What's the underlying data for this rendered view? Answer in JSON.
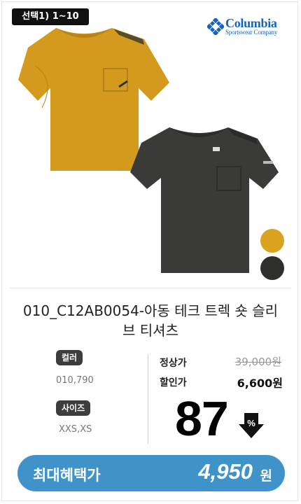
{
  "badge": {
    "label": "선택1) 1~10"
  },
  "brand": {
    "name": "Columbia",
    "sub": "Sportswear Company",
    "color": "#1565c0"
  },
  "product": {
    "title": "010_C12AB0054-아동 테크 트렉 숏 슬리브 티셔츠",
    "swatches": [
      "#d9a21f",
      "#2f302e"
    ]
  },
  "options": {
    "color_label": "컬러",
    "color_values": "010,790",
    "size_label": "사이즈",
    "size_values": "XXS,XS"
  },
  "price": {
    "regular_label": "정상가",
    "regular_value": "39,000원",
    "sale_label": "할인가",
    "sale_value": "6,600원",
    "discount_number": "87",
    "discount_symbol": "%"
  },
  "benefit": {
    "label": "최대혜택가",
    "price": "4,950",
    "unit": "원"
  }
}
